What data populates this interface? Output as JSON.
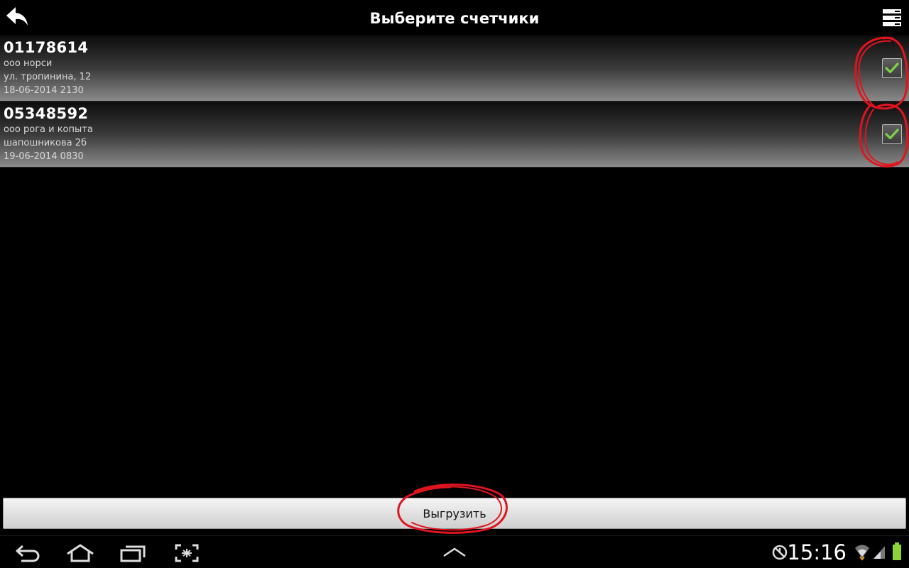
{
  "actionbar": {
    "title": "Выберите счетчики",
    "back_icon": "back-arrow-icon",
    "menu_icon": "list-menu-icon"
  },
  "meters": [
    {
      "number": "01178614",
      "company": "ооо норси",
      "address": "ул. тропинина, 12",
      "datetime": "18-06-2014 2130",
      "checked": true
    },
    {
      "number": "05348592",
      "company": "ооо рога и копыта",
      "address": "шапошникова 2б",
      "datetime": "19-06-2014 0830",
      "checked": true
    }
  ],
  "upload_button": {
    "label": "Выгрузить"
  },
  "system_bar": {
    "clock": "15:16",
    "icons": [
      "nav-back-icon",
      "home-icon",
      "recent-apps-icon",
      "screenshot-icon",
      "up-chevron-icon",
      "sync-icon",
      "wifi-icon",
      "signal-icon",
      "battery-icon"
    ]
  },
  "colors": {
    "check_green": "#7fd14a",
    "annotation_red": "#e0141e"
  }
}
